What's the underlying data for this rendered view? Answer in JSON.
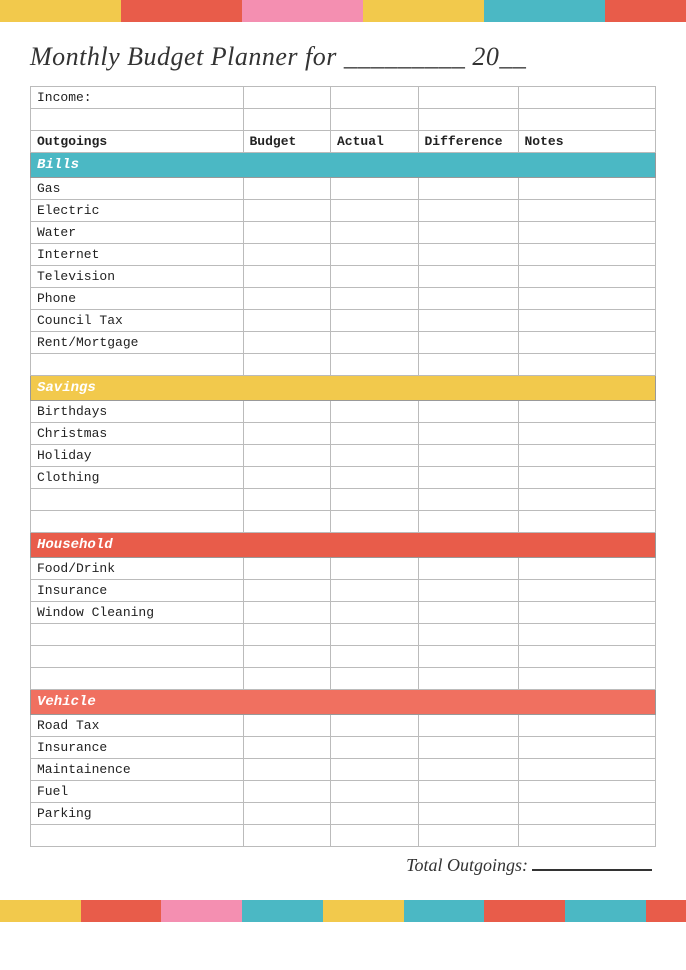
{
  "topBar": [
    {
      "color": "#f2c94c"
    },
    {
      "color": "#f2c94c"
    },
    {
      "color": "#f2c94c"
    },
    {
      "color": "#e85c4a"
    },
    {
      "color": "#e85c4a"
    },
    {
      "color": "#e85c4a"
    },
    {
      "color": "#f48fb1"
    },
    {
      "color": "#f48fb1"
    },
    {
      "color": "#f48fb1"
    },
    {
      "color": "#f2c94c"
    },
    {
      "color": "#f2c94c"
    },
    {
      "color": "#f2c94c"
    },
    {
      "color": "#4bb8c4"
    },
    {
      "color": "#4bb8c4"
    },
    {
      "color": "#4bb8c4"
    },
    {
      "color": "#e85c4a"
    },
    {
      "color": "#e85c4a"
    }
  ],
  "bottomBar": [
    {
      "color": "#f2c94c"
    },
    {
      "color": "#f2c94c"
    },
    {
      "color": "#e85c4a"
    },
    {
      "color": "#e85c4a"
    },
    {
      "color": "#f48fb1"
    },
    {
      "color": "#f48fb1"
    },
    {
      "color": "#4bb8c4"
    },
    {
      "color": "#4bb8c4"
    },
    {
      "color": "#f2c94c"
    },
    {
      "color": "#f2c94c"
    },
    {
      "color": "#4bb8c4"
    },
    {
      "color": "#4bb8c4"
    },
    {
      "color": "#e85c4a"
    },
    {
      "color": "#e85c4a"
    },
    {
      "color": "#4bb8c4"
    },
    {
      "color": "#4bb8c4"
    },
    {
      "color": "#e85c4a"
    }
  ],
  "title": "Monthly Budget Planner for _________ 20__",
  "columns": {
    "label": "Outgoings",
    "budget": "Budget",
    "actual": "Actual",
    "difference": "Difference",
    "notes": "Notes"
  },
  "incomeLabel": "Income:",
  "sections": {
    "bills": {
      "label": "Bills",
      "items": [
        "Gas",
        "Electric",
        "Water",
        "Internet",
        "Television",
        "Phone",
        "Council Tax",
        "Rent/Mortgage"
      ]
    },
    "savings": {
      "label": "Savings",
      "items": [
        "Birthdays",
        "Christmas",
        "Holiday",
        "Clothing"
      ]
    },
    "household": {
      "label": "Household",
      "items": [
        "Food/Drink",
        "Insurance",
        "Window Cleaning"
      ]
    },
    "vehicle": {
      "label": "Vehicle",
      "items": [
        "Road Tax",
        "Insurance",
        "Maintainence",
        "Fuel",
        "Parking"
      ]
    }
  },
  "totalLabel": "Total Outgoings:",
  "totalUnderline": "_____"
}
